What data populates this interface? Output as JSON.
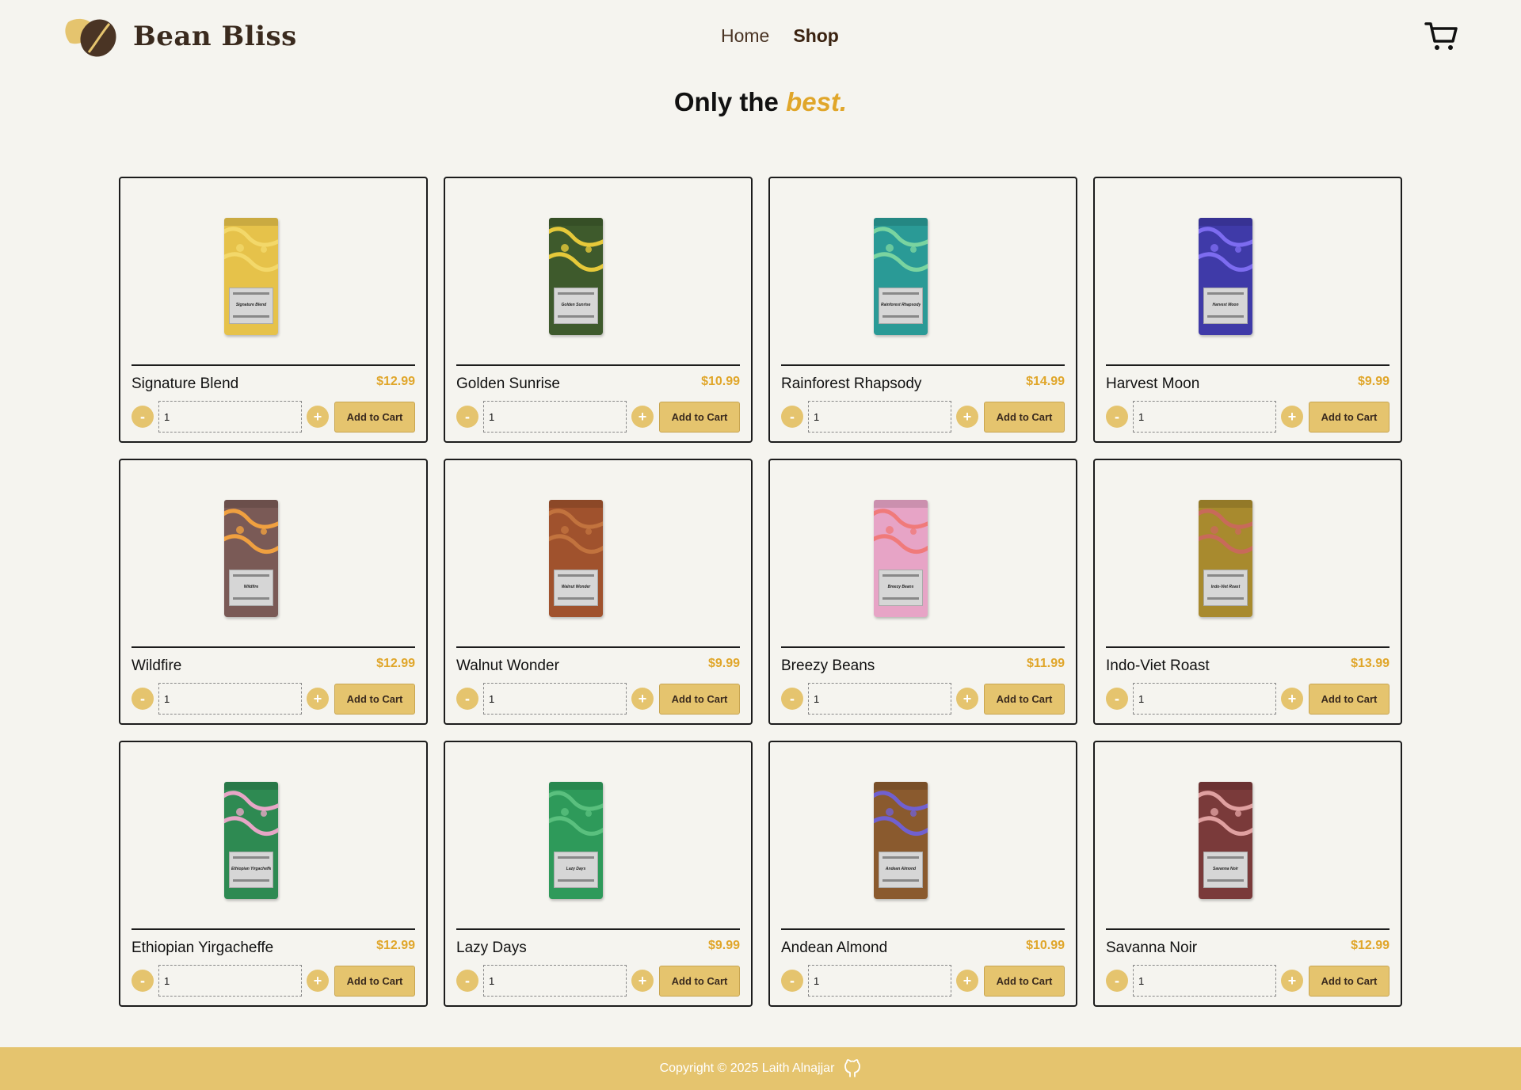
{
  "brand": {
    "name": "Bean Bliss"
  },
  "nav": {
    "home": "Home",
    "shop": "Shop"
  },
  "hero": {
    "prefix": "Only the",
    "accent": "best."
  },
  "colors": {
    "accent": "#e0a62a",
    "button": "#e5c46e",
    "background": "#f5f4ef"
  },
  "products": [
    {
      "name": "Signature Blend",
      "price": "$12.99",
      "qty": "1",
      "button": "Add to Cart",
      "bag_color": "#e6c24a",
      "pattern_color": "#f3d86a",
      "label_text": "Signature Blend"
    },
    {
      "name": "Golden Sunrise",
      "price": "$10.99",
      "qty": "1",
      "button": "Add to Cart",
      "bag_color": "#3e5a2c",
      "pattern_color": "#e6c93a",
      "label_text": "Golden Sunrise"
    },
    {
      "name": "Rainforest Rhapsody",
      "price": "$14.99",
      "qty": "1",
      "button": "Add to Cart",
      "bag_color": "#2a9a96",
      "pattern_color": "#7ad4a0",
      "label_text": "Rainforest Rhapsody"
    },
    {
      "name": "Harvest Moon",
      "price": "$9.99",
      "qty": "1",
      "button": "Add to Cart",
      "bag_color": "#3f3aa8",
      "pattern_color": "#7d6cf0",
      "label_text": "Harvest Moon"
    },
    {
      "name": "Wildfire",
      "price": "$12.99",
      "qty": "1",
      "button": "Add to Cart",
      "bag_color": "#7a5a56",
      "pattern_color": "#f0a040",
      "label_text": "Wildfire"
    },
    {
      "name": "Walnut Wonder",
      "price": "$9.99",
      "qty": "1",
      "button": "Add to Cart",
      "bag_color": "#a0522d",
      "pattern_color": "#c2733e",
      "label_text": "Walnut Wonder"
    },
    {
      "name": "Breezy Beans",
      "price": "$11.99",
      "qty": "1",
      "button": "Add to Cart",
      "bag_color": "#e7a4c6",
      "pattern_color": "#f07a7a",
      "label_text": "Breezy Beans"
    },
    {
      "name": "Indo-Viet Roast",
      "price": "$13.99",
      "qty": "1",
      "button": "Add to Cart",
      "bag_color": "#a88a2e",
      "pattern_color": "#c86a5a",
      "label_text": "Indo-Viet Roast"
    },
    {
      "name": "Ethiopian Yirgacheffe",
      "price": "$12.99",
      "qty": "1",
      "button": "Add to Cart",
      "bag_color": "#2e8a52",
      "pattern_color": "#e7a6c6",
      "label_text": "Ethiopian Yirgacheffe"
    },
    {
      "name": "Lazy Days",
      "price": "$9.99",
      "qty": "1",
      "button": "Add to Cart",
      "bag_color": "#2e9a5a",
      "pattern_color": "#5ac07e",
      "label_text": "Lazy Days"
    },
    {
      "name": "Andean Almond",
      "price": "$10.99",
      "qty": "1",
      "button": "Add to Cart",
      "bag_color": "#8a5a2e",
      "pattern_color": "#7060d0",
      "label_text": "Andean Almond"
    },
    {
      "name": "Savanna Noir",
      "price": "$12.99",
      "qty": "1",
      "button": "Add to Cart",
      "bag_color": "#7a3a3a",
      "pattern_color": "#e0a0a0",
      "label_text": "Savanna Noir"
    }
  ],
  "footer": {
    "copyright": "Copyright © 2025 Laith Alnajjar",
    "icon": "github-icon"
  }
}
